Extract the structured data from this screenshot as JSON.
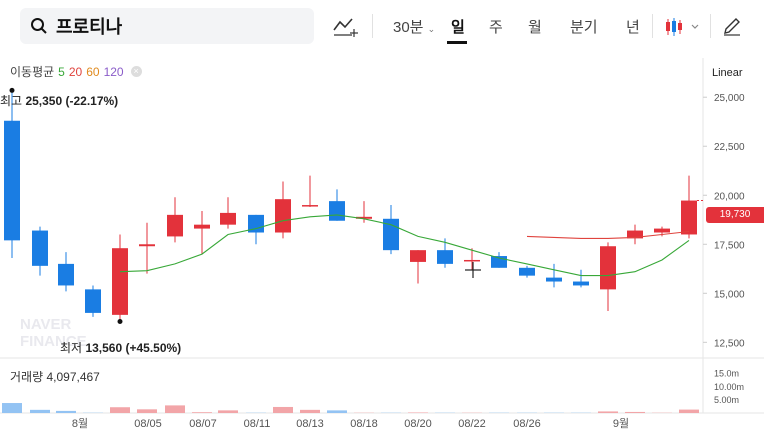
{
  "search": {
    "value": "프로티나"
  },
  "toolbar": {
    "interval": "30분",
    "periods": [
      "일",
      "주",
      "월",
      "분기",
      "년"
    ],
    "active_period": "일"
  },
  "moving_average": {
    "label": "이동평균",
    "periods": [
      {
        "value": "5",
        "color": "#38a838"
      },
      {
        "value": "20",
        "color": "#e0443e"
      },
      {
        "value": "60",
        "color": "#e08a1e"
      },
      {
        "value": "120",
        "color": "#8a5cc9"
      }
    ]
  },
  "scale_mode": "Linear",
  "high": {
    "prefix": "최고",
    "value": "25,350 (-22.17%)"
  },
  "low": {
    "prefix": "최저",
    "value": "13,560 (+45.50%)"
  },
  "current_price": "19,730",
  "volume": {
    "label": "거래량",
    "value": "4,097,467",
    "ticks": [
      "15.0m",
      "10.00m",
      "5.00m"
    ]
  },
  "colors": {
    "up": "#e3323b",
    "down": "#1a7de3",
    "ma5": "#38a838",
    "ma20": "#e0443e"
  },
  "chart_data": {
    "type": "candlestick",
    "y_ticks": [
      "25,000",
      "22,500",
      "20,000",
      "17,500",
      "15,000",
      "12,500"
    ],
    "y_range": [
      11700,
      27000
    ],
    "x_labels": [
      "8월",
      "08/05",
      "08/07",
      "08/11",
      "08/13",
      "08/18",
      "08/20",
      "08/22",
      "08/26",
      "9월"
    ],
    "candles": [
      {
        "o": 23800,
        "h": 25350,
        "l": 16800,
        "c": 17700
      },
      {
        "o": 18200,
        "h": 18400,
        "l": 15900,
        "c": 16400
      },
      {
        "o": 16500,
        "h": 17100,
        "l": 15100,
        "c": 15400
      },
      {
        "o": 15200,
        "h": 15400,
        "l": 13800,
        "c": 14000
      },
      {
        "o": 13900,
        "h": 18000,
        "l": 13560,
        "c": 17300
      },
      {
        "o": 17400,
        "h": 18600,
        "l": 16000,
        "c": 17500
      },
      {
        "o": 17900,
        "h": 19900,
        "l": 17600,
        "c": 19000
      },
      {
        "o": 18300,
        "h": 19200,
        "l": 17000,
        "c": 18500
      },
      {
        "o": 18500,
        "h": 19900,
        "l": 18300,
        "c": 19100
      },
      {
        "o": 19000,
        "h": 19000,
        "l": 17500,
        "c": 18100
      },
      {
        "o": 18100,
        "h": 20700,
        "l": 17800,
        "c": 19800
      },
      {
        "o": 19500,
        "h": 21000,
        "l": 19400,
        "c": 19500
      },
      {
        "o": 19700,
        "h": 20300,
        "l": 18700,
        "c": 18700
      },
      {
        "o": 18800,
        "h": 19700,
        "l": 18600,
        "c": 18900
      },
      {
        "o": 18800,
        "h": 19500,
        "l": 17000,
        "c": 17200
      },
      {
        "o": 16600,
        "h": 17200,
        "l": 15500,
        "c": 17200
      },
      {
        "o": 17200,
        "h": 17800,
        "l": 16300,
        "c": 16500
      },
      {
        "o": 16700,
        "h": 17300,
        "l": 16200,
        "c": 16700
      },
      {
        "o": 16900,
        "h": 17100,
        "l": 16300,
        "c": 16300
      },
      {
        "o": 16300,
        "h": 16400,
        "l": 15800,
        "c": 15900
      },
      {
        "o": 15800,
        "h": 16500,
        "l": 15300,
        "c": 15600
      },
      {
        "o": 15600,
        "h": 16200,
        "l": 15300,
        "c": 15400
      },
      {
        "o": 15200,
        "h": 17600,
        "l": 14100,
        "c": 17400
      },
      {
        "o": 17800,
        "h": 18500,
        "l": 17500,
        "c": 18200
      },
      {
        "o": 18100,
        "h": 18400,
        "l": 17900,
        "c": 18300
      },
      {
        "o": 18000,
        "h": 21000,
        "l": 17800,
        "c": 19730
      }
    ],
    "ma5": [
      null,
      null,
      null,
      null,
      16100,
      16150,
      16500,
      17000,
      18000,
      18300,
      18700,
      18900,
      19000,
      18800,
      18500,
      17900,
      17600,
      17200,
      16800,
      16500,
      16200,
      15900,
      15900,
      16100,
      16700,
      17700
    ],
    "ma20": [
      null,
      null,
      null,
      null,
      null,
      null,
      null,
      null,
      null,
      null,
      null,
      null,
      null,
      null,
      null,
      null,
      null,
      null,
      null,
      17900,
      17850,
      17800,
      17800,
      17850,
      18000,
      18150
    ],
    "volume_m": [
      3.8,
      1.2,
      0.8,
      0.1,
      2.2,
      1.4,
      2.9,
      0.3,
      1.0,
      0.1,
      2.3,
      1.2,
      1.0,
      0.1,
      0.1,
      0.2,
      0.1,
      0.1,
      0.1,
      0.1,
      0.1,
      0.1,
      0.6,
      0.4,
      0.1,
      1.3
    ],
    "volume_range": [
      0,
      16
    ]
  }
}
